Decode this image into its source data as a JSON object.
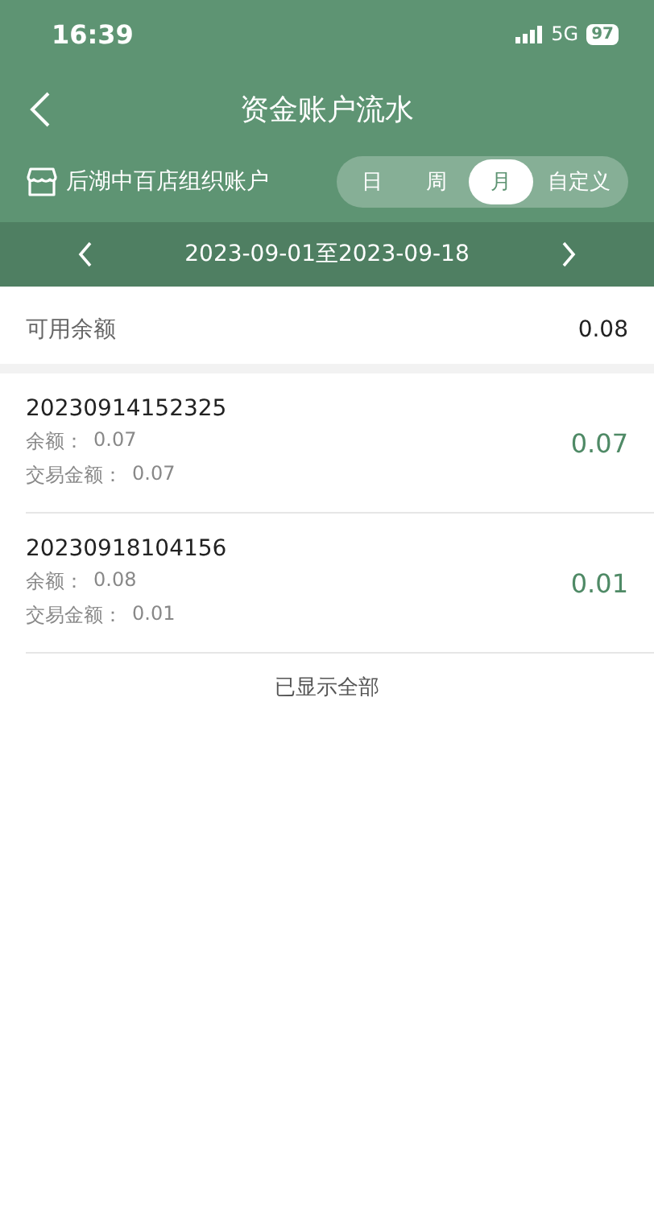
{
  "status_bar": {
    "time": "16:39",
    "network": "5G",
    "battery": "97"
  },
  "nav": {
    "title": "资金账户流水"
  },
  "account": {
    "name": "后湖中百店组织账户"
  },
  "periods": [
    {
      "label": "日",
      "selected": false
    },
    {
      "label": "周",
      "selected": false
    },
    {
      "label": "月",
      "selected": true
    },
    {
      "label": "自定义",
      "selected": false
    }
  ],
  "date_range": {
    "text": "2023-09-01至2023-09-18"
  },
  "available": {
    "label": "可用余额",
    "value": "0.08"
  },
  "transactions": [
    {
      "id": "20230914152325",
      "balance_label": "余额：",
      "balance": "0.07",
      "amount_label": "交易金额：",
      "amount": "0.07",
      "value": "0.07"
    },
    {
      "id": "20230918104156",
      "balance_label": "余额：",
      "balance": "0.08",
      "amount_label": "交易金额：",
      "amount": "0.01",
      "value": "0.01"
    }
  ],
  "footer": "已显示全部"
}
